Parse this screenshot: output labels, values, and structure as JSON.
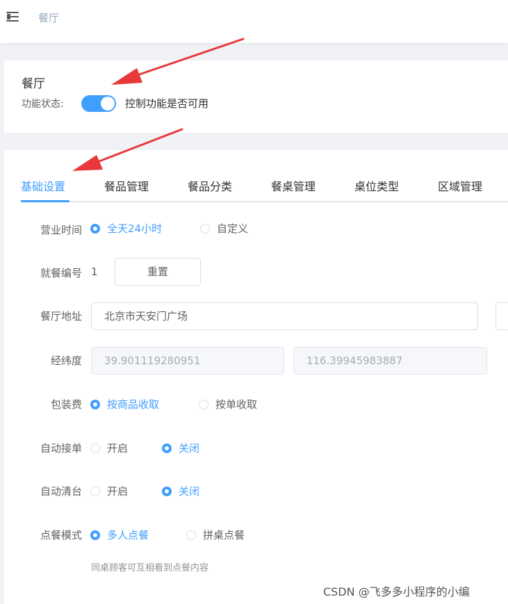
{
  "header": {
    "breadcrumb": "餐厅"
  },
  "feature_card": {
    "title": "餐厅",
    "status_label": "功能状态:",
    "switch_on": true,
    "switch_desc": "控制功能是否可用"
  },
  "tabs": [
    {
      "label": "基础设置",
      "active": true
    },
    {
      "label": "餐品管理",
      "active": false
    },
    {
      "label": "餐品分类",
      "active": false
    },
    {
      "label": "餐桌管理",
      "active": false
    },
    {
      "label": "桌位类型",
      "active": false
    },
    {
      "label": "区域管理",
      "active": false
    }
  ],
  "form": {
    "business_hours": {
      "label": "营业时间",
      "options": [
        "全天24小时",
        "自定义"
      ],
      "selected": "全天24小时"
    },
    "meal_number": {
      "label": "就餐编号",
      "value": "1",
      "reset_button": "重置"
    },
    "address": {
      "label": "餐厅地址",
      "value": "北京市天安门广场"
    },
    "coordinates": {
      "label": "经纬度",
      "latitude": "39.901119280951",
      "longitude": "116.39945983887"
    },
    "packing_fee": {
      "label": "包装费",
      "options": [
        "按商品收取",
        "按单收取"
      ],
      "selected": "按商品收取"
    },
    "auto_accept": {
      "label": "自动接单",
      "options": [
        "开启",
        "关闭"
      ],
      "selected": "关闭"
    },
    "auto_clear": {
      "label": "自动清台",
      "options": [
        "开启",
        "关闭"
      ],
      "selected": "关闭"
    },
    "order_mode": {
      "label": "点餐模式",
      "options": [
        "多人点餐",
        "拼桌点餐"
      ],
      "selected": "多人点餐",
      "hint": "同桌顾客可互相看到点餐内容"
    }
  },
  "watermark": "CSDN @飞多多小程序的小编",
  "colors": {
    "accent": "#409eff",
    "annotation_arrow": "#e8383b"
  }
}
